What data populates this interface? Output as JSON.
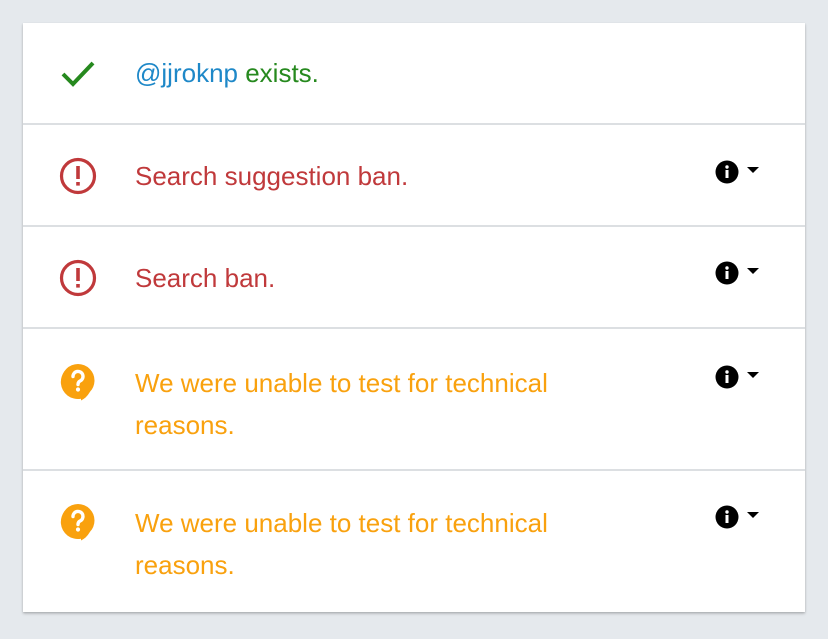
{
  "results": [
    {
      "status": "ok",
      "icon": "check-icon",
      "handle": "@jjroknp",
      "text": " exists."
    },
    {
      "status": "ban",
      "icon": "alert-circle-icon",
      "text": "Search suggestion ban.",
      "details_icon": "info-icon",
      "toggle_icon": "caret-down-icon"
    },
    {
      "status": "ban",
      "icon": "alert-circle-icon",
      "text": "Search ban.",
      "details_icon": "info-icon",
      "toggle_icon": "caret-down-icon"
    },
    {
      "status": "unknown",
      "icon": "help-bubble-icon",
      "text": "We were unable to test for technical reasons.",
      "details_icon": "info-icon",
      "toggle_icon": "caret-down-icon"
    },
    {
      "status": "unknown",
      "icon": "help-bubble-icon",
      "text": "We were unable to test for technical reasons.",
      "details_icon": "info-icon",
      "toggle_icon": "caret-down-icon"
    }
  ],
  "colors": {
    "ok": "#26891e",
    "handle": "#1e88c8",
    "ban": "#c0393b",
    "unknown": "#f9a10e",
    "background": "#e5e9ed"
  }
}
